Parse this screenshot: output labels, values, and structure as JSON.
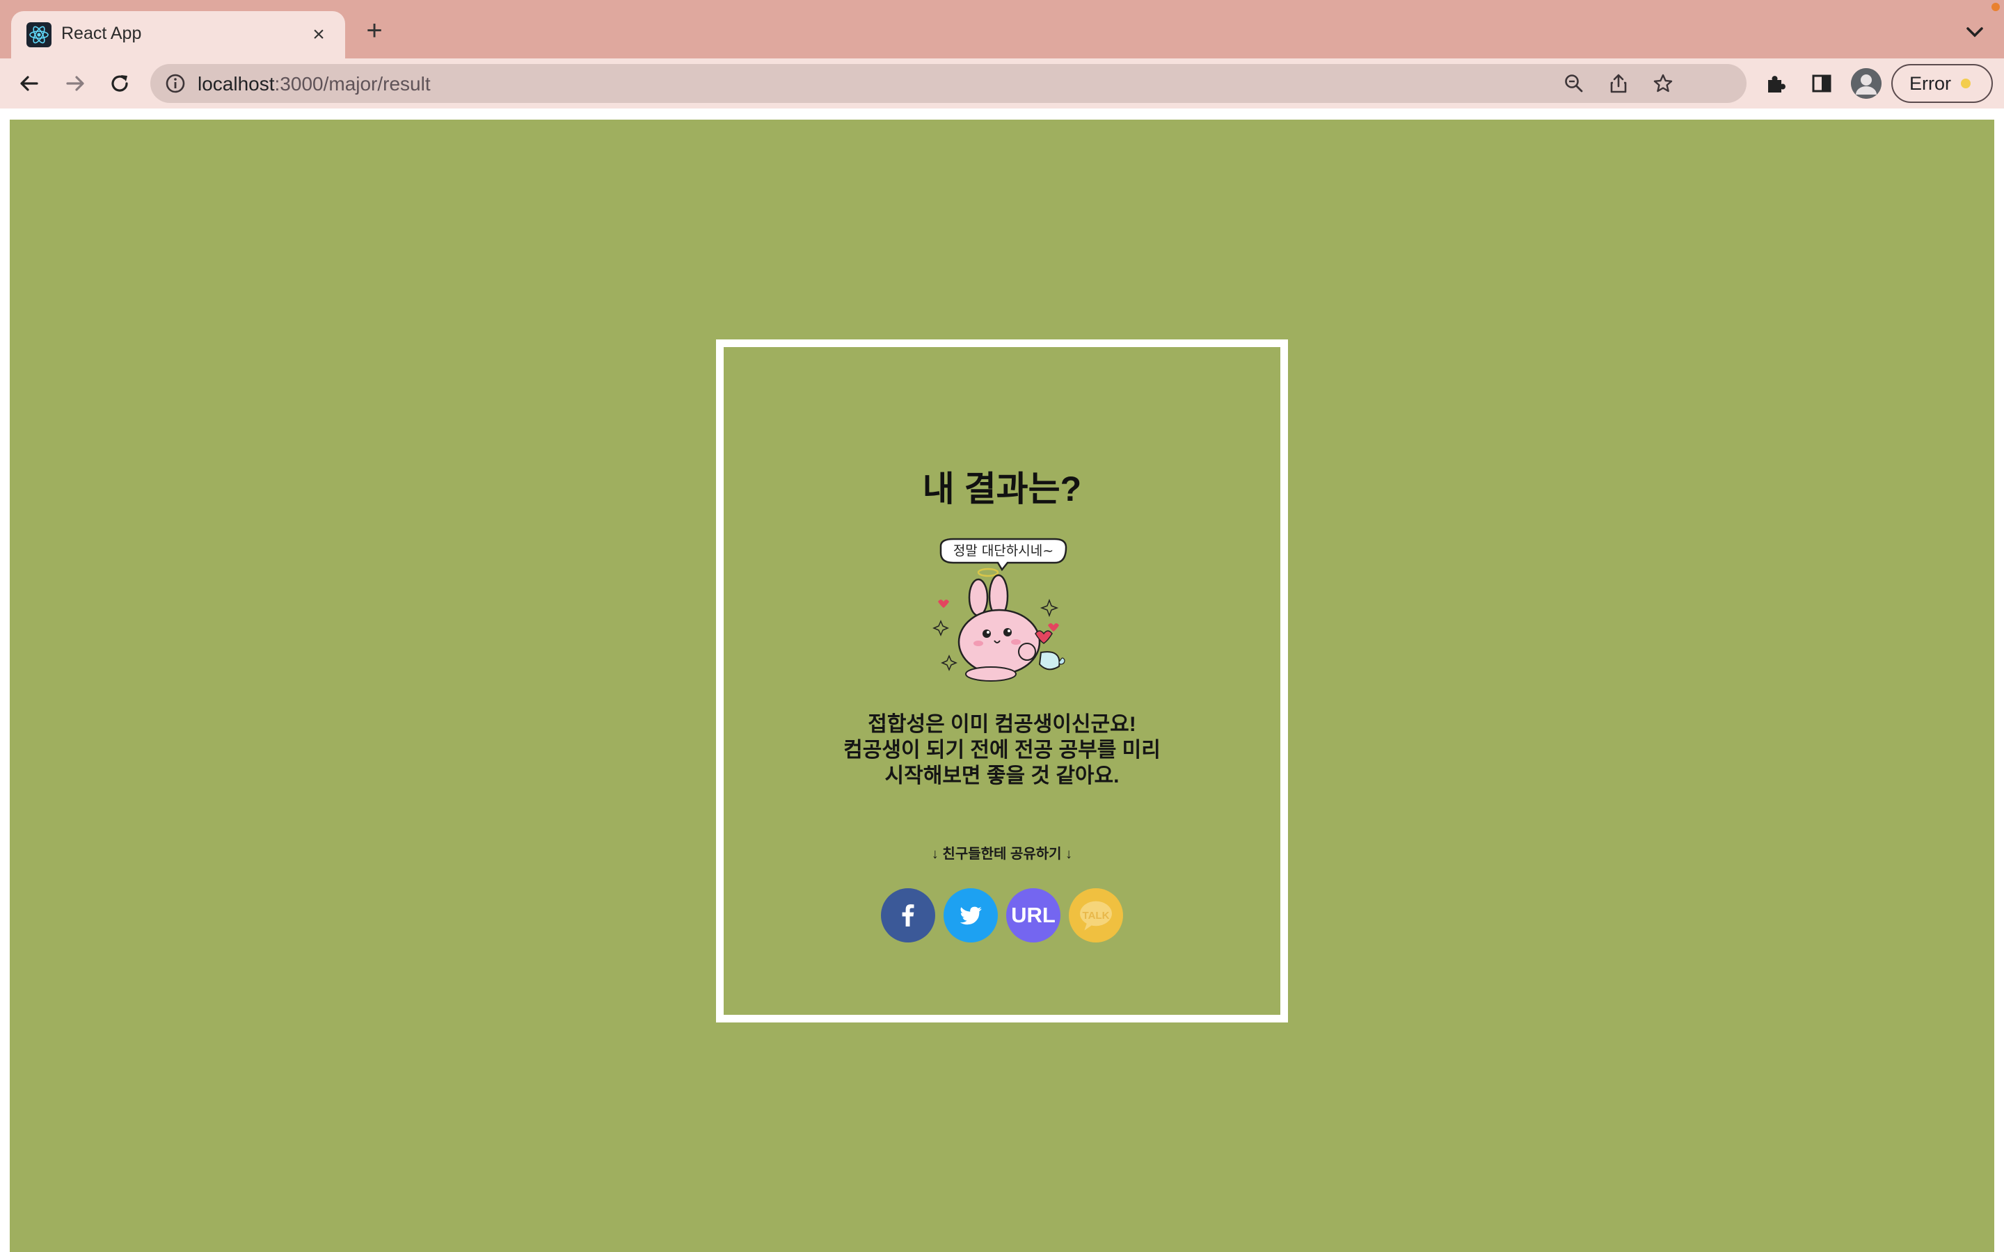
{
  "browser": {
    "tab_title": "React App",
    "tab_close": "×",
    "new_tab": "+",
    "url_host": "localhost",
    "url_rest": ":3000/major/result",
    "profile_status": "Error"
  },
  "page": {
    "background_color": "#9faf5f",
    "card_title": "내 결과는?",
    "mascot_caption": "정말 대단하시네~",
    "result_lines": [
      "접합성은 이미 컴공생이신군요!",
      "컴공생이 되기 전에 전공 공부를 미리",
      "시작해보면 좋을 것 같아요."
    ],
    "share_label": "↓ 친구들한테 공유하기 ↓",
    "share_buttons": {
      "facebook": {
        "icon": "facebook-icon",
        "color": "#3b5998"
      },
      "twitter": {
        "icon": "twitter-icon",
        "color": "#1da1f2"
      },
      "url": {
        "label": "URL",
        "color": "#7466f0"
      },
      "kakao": {
        "label": "TALK",
        "color": "#f0c040"
      }
    }
  }
}
